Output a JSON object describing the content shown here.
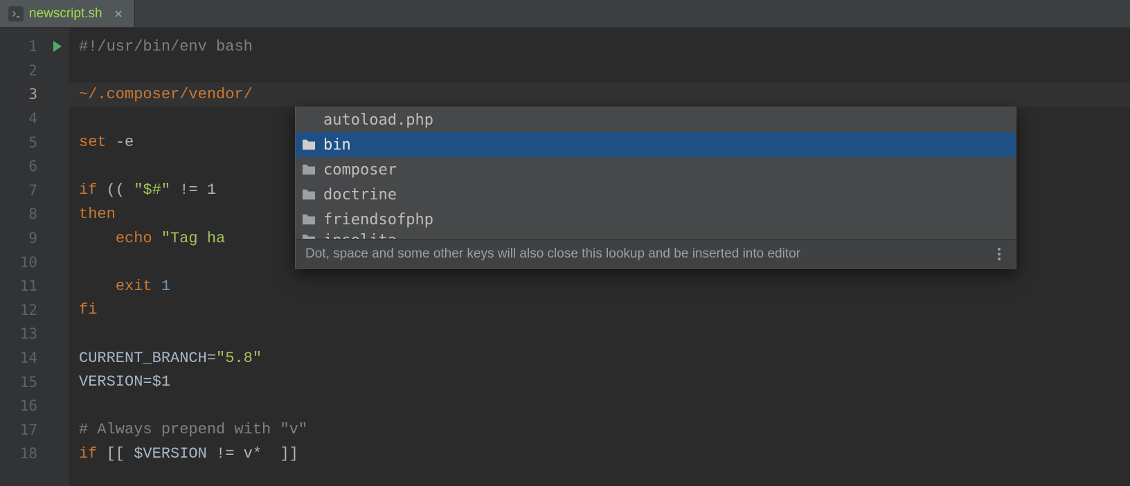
{
  "tab": {
    "filename": "newscript.sh",
    "icon": "shell-file-icon"
  },
  "gutter": {
    "lines": [
      "1",
      "2",
      "3",
      "4",
      "5",
      "6",
      "7",
      "8",
      "9",
      "10",
      "11",
      "12",
      "13",
      "14",
      "15",
      "16",
      "17",
      "18"
    ],
    "current_line_index": 2,
    "run_marker_line_index": 0
  },
  "code": {
    "shebang_prefix": "#!",
    "shebang_path": "/usr/bin/env bash",
    "path_line": "~/.composer/vendor/",
    "set_cmd": "set",
    "set_flag": "-e",
    "if_open": "if ",
    "if_cond_pre": "(( ",
    "if_cond_var": "\"$#\"",
    "if_cond_post": " != 1 ",
    "then_kw": "then",
    "echo_indent": "    ",
    "echo_cmd": "echo",
    "echo_sp": " ",
    "echo_str": "\"Tag ha",
    "exit_indent": "    ",
    "exit_cmd": "exit",
    "exit_sp": " ",
    "exit_code": "1",
    "fi_kw": "fi",
    "cb_var": "CURRENT_BRANCH",
    "cb_eq": "=",
    "cb_val": "\"5.8\"",
    "ver_var": "VERSION",
    "ver_eq": "=",
    "ver_val": "$1",
    "comment_line": "# Always prepend with \"v\"",
    "if2_kw": "if",
    "if2_sp": " ",
    "if2_open": "[[ ",
    "if2_var": "$VERSION",
    "if2_rest": " != v*  ]]"
  },
  "completion": {
    "items": [
      {
        "label": "autoload.php",
        "type": "file",
        "selected": false
      },
      {
        "label": "bin",
        "type": "folder",
        "selected": true
      },
      {
        "label": "composer",
        "type": "folder",
        "selected": false
      },
      {
        "label": "doctrine",
        "type": "folder",
        "selected": false
      },
      {
        "label": "friendsofphp",
        "type": "folder",
        "selected": false
      },
      {
        "label": "insolita",
        "type": "folder",
        "selected": false,
        "partial": true
      }
    ],
    "hint": "Dot, space and some other keys will also close this lookup and be inserted into editor"
  }
}
